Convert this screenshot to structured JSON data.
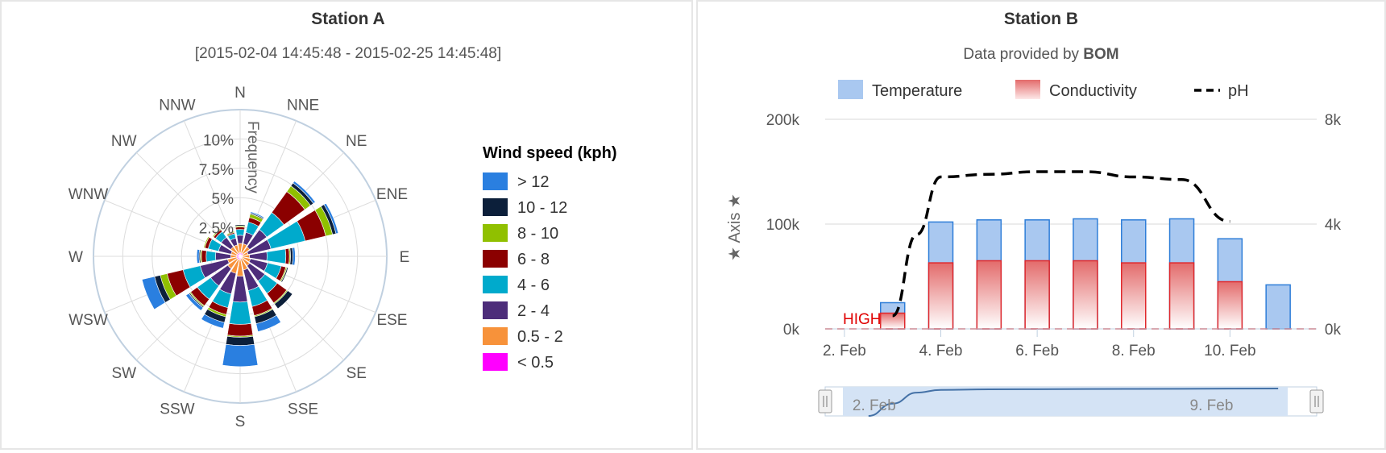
{
  "colors": {
    "legend_title": "#000000",
    "speed_colors": [
      "#ff00ff",
      "#f7923a",
      "#4d2d7a",
      "#00aacc",
      "#8b0000",
      "#90c000",
      "#0c1f3a",
      "#2a7fe0"
    ],
    "temperature_fill": "#a9c8f0",
    "temperature_border": "#2f7ed8",
    "conductivity_border": "#e0282c",
    "ph_line": "#000000",
    "plotline": "#e00000",
    "grid": "#d9d9d9",
    "navigator_fill": "#d4e3f5",
    "navigator_line": "#4572a7"
  },
  "chart_data": [
    {
      "type": "windrose",
      "title": "Station A",
      "subtitle": "[2015-02-04 14:45:48 - 2015-02-25 14:45:48]",
      "radial_axis_title": "Frequency",
      "radial_ticks": [
        "2.5%",
        "5%",
        "7.5%",
        "10%"
      ],
      "radial_max": 12.5,
      "directions": [
        "N",
        "NNE",
        "NE",
        "ENE",
        "E",
        "ESE",
        "SE",
        "SSE",
        "S",
        "SSW",
        "SW",
        "WSW",
        "W",
        "WNW",
        "NW",
        "NNW"
      ],
      "legend_title": "Wind speed (kph)",
      "legend_placement": "right",
      "series": [
        {
          "name": "< 0.5",
          "values": [
            0.3,
            0.3,
            0.3,
            0.2,
            0.2,
            0.2,
            0.2,
            0.2,
            0.3,
            0.3,
            0.3,
            0.3,
            0.3,
            0.3,
            0.3,
            0.3
          ]
        },
        {
          "name": "0.5 - 2",
          "values": [
            0.8,
            0.8,
            0.7,
            0.5,
            0.6,
            0.7,
            0.8,
            1.0,
            1.4,
            1.2,
            1.0,
            0.8,
            0.5,
            0.5,
            0.7,
            0.7
          ]
        },
        {
          "name": "2 - 4",
          "values": [
            0.7,
            1.0,
            1.8,
            2.0,
            1.5,
            1.5,
            1.6,
            1.8,
            2.2,
            1.8,
            1.8,
            2.4,
            1.3,
            1.1,
            1.0,
            0.6
          ]
        },
        {
          "name": "4 - 6",
          "values": [
            0.5,
            0.9,
            1.8,
            3.0,
            1.6,
            1.2,
            1.3,
            1.4,
            1.9,
            1.2,
            1.4,
            1.5,
            0.8,
            0.9,
            0.6,
            0.4
          ]
        },
        {
          "name": "6 - 8",
          "values": [
            0.2,
            0.4,
            2.2,
            1.8,
            0.3,
            0.4,
            1.0,
            0.8,
            1.0,
            0.6,
            0.7,
            1.4,
            0.4,
            0.3,
            0.2,
            0.1
          ]
        },
        {
          "name": "8 - 10",
          "values": [
            0.1,
            0.3,
            0.6,
            0.6,
            0.1,
            0.1,
            0.1,
            0.1,
            0.1,
            0.2,
            0.1,
            0.6,
            0.1,
            0.1,
            0.1,
            0.1
          ]
        },
        {
          "name": "10 - 12",
          "values": [
            0.1,
            0.1,
            0.3,
            0.3,
            0.2,
            0.1,
            0.5,
            0.6,
            0.7,
            0.5,
            0.1,
            0.5,
            0.1,
            0.0,
            0.0,
            0.0
          ]
        },
        {
          "name": "> 12",
          "values": [
            0.0,
            0.1,
            0.2,
            0.2,
            0.2,
            0.0,
            0.0,
            0.7,
            1.8,
            0.5,
            0.3,
            1.1,
            0.2,
            0.0,
            0.0,
            0.0
          ]
        }
      ]
    },
    {
      "type": "bar",
      "title": "Station B",
      "subtitle_prefix": "Data provided by ",
      "subtitle_bold": "BOM",
      "ylabel_left": "★ Axis ★",
      "ylim_left": [
        0,
        200000
      ],
      "left_ticks": [
        "0k",
        "100k",
        "200k"
      ],
      "ylim_right": [
        0,
        8000
      ],
      "right_ticks": [
        "0k",
        "4k",
        "8k"
      ],
      "x_ticks": [
        "2. Feb",
        "4. Feb",
        "6. Feb",
        "8. Feb",
        "10. Feb"
      ],
      "x_tick_days": [
        2,
        4,
        6,
        8,
        10
      ],
      "xlim_days": [
        1.6,
        11.8
      ],
      "plotline_label": "HIGH",
      "plotline_value": 0,
      "legend_placement": "top",
      "series": [
        {
          "name": "Temperature",
          "kind": "column",
          "x_days": [
            3,
            4,
            5,
            6,
            7,
            8,
            9,
            10,
            11
          ],
          "values": [
            25000,
            102000,
            104000,
            104000,
            105000,
            104000,
            105000,
            86000,
            42000
          ]
        },
        {
          "name": "Conductivity",
          "kind": "column",
          "x_days": [
            3,
            4,
            5,
            6,
            7,
            8,
            9,
            10
          ],
          "values": [
            15000,
            63000,
            65000,
            65000,
            65000,
            63000,
            63000,
            45000
          ]
        },
        {
          "name": "pH",
          "kind": "dashed-line",
          "axis": "right",
          "x_days": [
            3,
            3.5,
            4,
            5,
            6,
            7,
            8,
            9,
            10
          ],
          "values": [
            500,
            3600,
            5800,
            5900,
            6000,
            6000,
            5800,
            5700,
            4100
          ]
        }
      ],
      "navigator": {
        "labels": [
          "2. Feb",
          "9. Feb"
        ],
        "label_days": [
          2,
          9
        ],
        "xlim_days": [
          1.6,
          11.8
        ],
        "series_days": [
          2.5,
          3,
          3.5,
          4,
          5,
          7,
          9,
          11
        ],
        "series_values": [
          0.0,
          0.45,
          0.85,
          0.95,
          0.97,
          0.98,
          0.99,
          1.0
        ]
      }
    }
  ]
}
